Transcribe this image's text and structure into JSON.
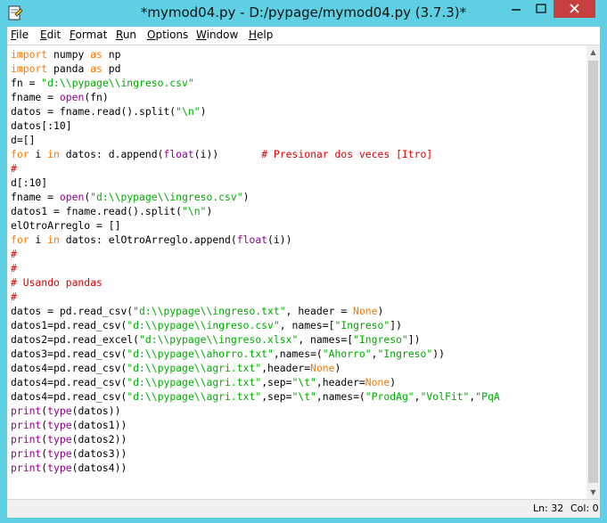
{
  "window": {
    "title": "*mymod04.py - D:/pypage/mymod04.py (3.7.3)*",
    "title_bar_color": "#5fd0e4",
    "close_button_color": "#c7403f",
    "icon": "python-idle-icon"
  },
  "title_buttons": {
    "minimize": "—",
    "maximize": "□",
    "close": "✕"
  },
  "menu": {
    "items": [
      {
        "label": "File",
        "name": "menu-file"
      },
      {
        "label": "Edit",
        "name": "menu-edit"
      },
      {
        "label": "Format",
        "name": "menu-format"
      },
      {
        "label": "Run",
        "name": "menu-run"
      },
      {
        "label": "Options",
        "name": "menu-options"
      },
      {
        "label": "Window",
        "name": "menu-window"
      },
      {
        "label": "Help",
        "name": "menu-help"
      }
    ]
  },
  "syntax_colors": {
    "keyword": "#ff7700",
    "builtin": "#900090",
    "string": "#00aa00",
    "comment": "#dd0000",
    "default": "#000000"
  },
  "code": {
    "lines": [
      [
        [
          "keyword",
          "import"
        ],
        [
          "default",
          " numpy "
        ],
        [
          "keyword",
          "as"
        ],
        [
          "default",
          " np"
        ]
      ],
      [
        [
          "keyword",
          "import"
        ],
        [
          "default",
          " panda "
        ],
        [
          "keyword",
          "as"
        ],
        [
          "default",
          " pd"
        ]
      ],
      [
        [
          "default",
          "fn = "
        ],
        [
          "string",
          "\"d:\\\\pypage\\\\ingreso.csv\""
        ]
      ],
      [
        [
          "default",
          "fname = "
        ],
        [
          "builtin",
          "open"
        ],
        [
          "default",
          "(fn)"
        ]
      ],
      [
        [
          "default",
          "datos = fname.read().split("
        ],
        [
          "string",
          "\"\\n\""
        ],
        [
          "default",
          ")"
        ]
      ],
      [
        [
          "default",
          "datos[:10]"
        ]
      ],
      [
        [
          "default",
          "d=[]"
        ]
      ],
      [
        [
          "keyword",
          "for"
        ],
        [
          "default",
          " i "
        ],
        [
          "keyword",
          "in"
        ],
        [
          "default",
          " datos: d.append("
        ],
        [
          "builtin",
          "float"
        ],
        [
          "default",
          "(i))       "
        ],
        [
          "comment",
          "# Presionar dos veces [Itro]"
        ]
      ],
      [
        [
          "comment",
          "#"
        ]
      ],
      [
        [
          "default",
          "d[:10]"
        ]
      ],
      [
        [
          "default",
          "fname = "
        ],
        [
          "builtin",
          "open"
        ],
        [
          "default",
          "("
        ],
        [
          "string",
          "\"d:\\\\pypage\\\\ingreso.csv\""
        ],
        [
          "default",
          ")"
        ]
      ],
      [
        [
          "default",
          "datos1 = fname.read().split("
        ],
        [
          "string",
          "\"\\n\""
        ],
        [
          "default",
          ")"
        ]
      ],
      [
        [
          "default",
          "elOtroArreglo = []"
        ]
      ],
      [
        [
          "keyword",
          "for"
        ],
        [
          "default",
          " i "
        ],
        [
          "keyword",
          "in"
        ],
        [
          "default",
          " datos: elOtroArreglo.append("
        ],
        [
          "builtin",
          "float"
        ],
        [
          "default",
          "(i))"
        ]
      ],
      [
        [
          "comment",
          "#"
        ]
      ],
      [
        [
          "comment",
          "#"
        ]
      ],
      [
        [
          "comment",
          "# Usando pandas"
        ]
      ],
      [
        [
          "comment",
          "#"
        ]
      ],
      [
        [
          "default",
          "datos = pd.read_csv("
        ],
        [
          "string",
          "\"d:\\\\pypage\\\\ingreso.txt\""
        ],
        [
          "default",
          ", header = "
        ],
        [
          "keyword",
          "None"
        ],
        [
          "default",
          ")"
        ]
      ],
      [
        [
          "default",
          "datos1=pd.read_csv("
        ],
        [
          "string",
          "\"d:\\\\pypage\\\\ingreso.csv\""
        ],
        [
          "default",
          ", names=["
        ],
        [
          "string",
          "\"Ingreso\""
        ],
        [
          "default",
          "])"
        ]
      ],
      [
        [
          "default",
          "datos2=pd.read_excel("
        ],
        [
          "string",
          "\"d:\\\\pypage\\\\ingreso.xlsx\""
        ],
        [
          "default",
          ", names=["
        ],
        [
          "string",
          "\"Ingreso\""
        ],
        [
          "default",
          "])"
        ]
      ],
      [
        [
          "default",
          "datos3=pd.read_csv("
        ],
        [
          "string",
          "\"d:\\\\pypage\\\\ahorro.txt\""
        ],
        [
          "default",
          ",names=("
        ],
        [
          "string",
          "\"Ahorro\""
        ],
        [
          "default",
          ","
        ],
        [
          "string",
          "\"Ingreso\""
        ],
        [
          "default",
          "))"
        ]
      ],
      [
        [
          "default",
          "datos4=pd.read_csv("
        ],
        [
          "string",
          "\"d:\\\\pypage\\\\agri.txt\""
        ],
        [
          "default",
          ",header="
        ],
        [
          "keyword",
          "None"
        ],
        [
          "default",
          ")"
        ]
      ],
      [
        [
          "default",
          "datos4=pd.read_csv("
        ],
        [
          "string",
          "\"d:\\\\pypage\\\\agri.txt\""
        ],
        [
          "default",
          ",sep="
        ],
        [
          "string",
          "\"\\t\""
        ],
        [
          "default",
          ",header="
        ],
        [
          "keyword",
          "None"
        ],
        [
          "default",
          ")"
        ]
      ],
      [
        [
          "default",
          "datos4=pd.read_csv("
        ],
        [
          "string",
          "\"d:\\\\pypage\\\\agri.txt\""
        ],
        [
          "default",
          ",sep="
        ],
        [
          "string",
          "\"\\t\""
        ],
        [
          "default",
          ",names=("
        ],
        [
          "string",
          "\"ProdAg\""
        ],
        [
          "default",
          ","
        ],
        [
          "string",
          "\"VolFit\""
        ],
        [
          "default",
          ","
        ],
        [
          "string",
          "\"PqA"
        ]
      ],
      [
        [
          "builtin",
          "print"
        ],
        [
          "default",
          "("
        ],
        [
          "builtin",
          "type"
        ],
        [
          "default",
          "(datos))"
        ]
      ],
      [
        [
          "builtin",
          "print"
        ],
        [
          "default",
          "("
        ],
        [
          "builtin",
          "type"
        ],
        [
          "default",
          "(datos1))"
        ]
      ],
      [
        [
          "builtin",
          "print"
        ],
        [
          "default",
          "("
        ],
        [
          "builtin",
          "type"
        ],
        [
          "default",
          "(datos2))"
        ]
      ],
      [
        [
          "builtin",
          "print"
        ],
        [
          "default",
          "("
        ],
        [
          "builtin",
          "type"
        ],
        [
          "default",
          "(datos3))"
        ]
      ],
      [
        [
          "builtin",
          "print"
        ],
        [
          "default",
          "("
        ],
        [
          "builtin",
          "type"
        ],
        [
          "default",
          "(datos4))"
        ]
      ]
    ]
  },
  "scrollbar": {
    "up_arrow": "▲",
    "down_arrow": "▼"
  },
  "status": {
    "line": "Ln: 32",
    "col": "Col: 0"
  }
}
